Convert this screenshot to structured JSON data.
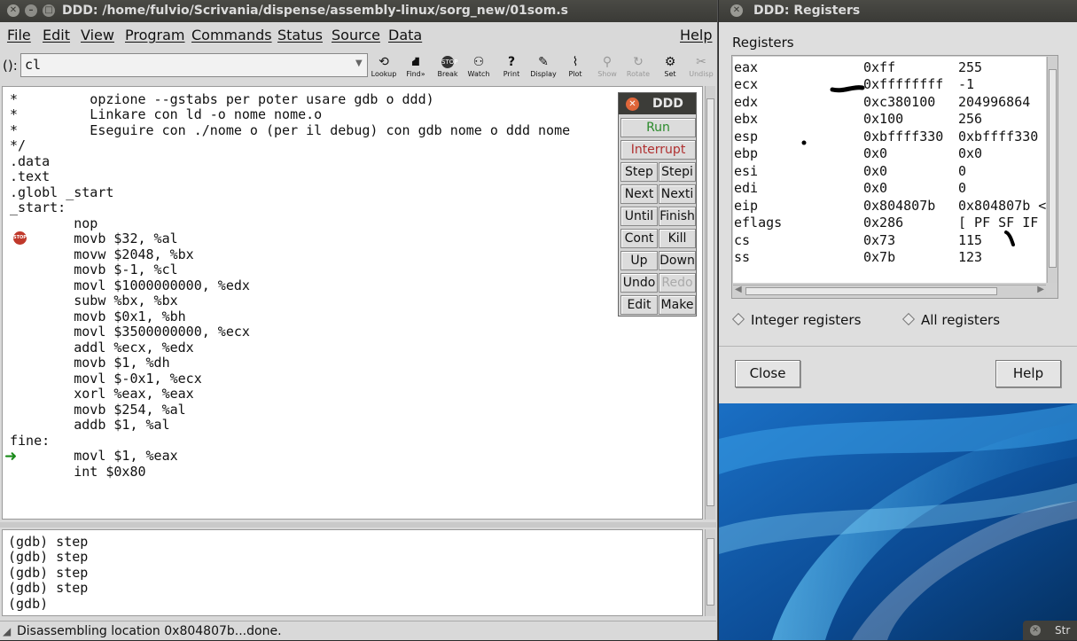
{
  "main_window": {
    "title": "DDD: /home/fulvio/Scrivania/dispense/assembly-linux/sorg_new/01som.s",
    "menu": [
      "File",
      "Edit",
      "View",
      "Program",
      "Commands",
      "Status",
      "Source",
      "Data",
      "Help"
    ],
    "arg_label": "():",
    "arg_value": "cl",
    "toolbar": [
      {
        "label": "Lookup",
        "icon": "lookup-icon",
        "enabled": true
      },
      {
        "label": "Find»",
        "icon": "find-icon",
        "enabled": true
      },
      {
        "label": "Break",
        "icon": "break-stop-icon",
        "enabled": true
      },
      {
        "label": "Watch",
        "icon": "watch-icon",
        "enabled": true
      },
      {
        "label": "Print",
        "icon": "print-icon",
        "enabled": true
      },
      {
        "label": "Display",
        "icon": "display-icon",
        "enabled": true
      },
      {
        "label": "Plot",
        "icon": "plot-icon",
        "enabled": true
      },
      {
        "label": "Show",
        "icon": "show-icon",
        "enabled": false
      },
      {
        "label": "Rotate",
        "icon": "rotate-icon",
        "enabled": false
      },
      {
        "label": "Set",
        "icon": "set-icon",
        "enabled": true
      },
      {
        "label": "Undisp",
        "icon": "undisp-icon",
        "enabled": false
      }
    ],
    "source_lines": [
      "*         opzione --gstabs per poter usare gdb o ddd)",
      "*         Linkare con ld -o nome nome.o",
      "*         Eseguire con ./nome o (per il debug) con gdb nome o ddd nome",
      "*/",
      ".data",
      ".text",
      ".globl _start",
      "_start:",
      "        nop",
      "        movb $32, %al",
      "        movw $2048, %bx",
      "        movb $-1, %cl",
      "        movl $1000000000, %edx",
      "        subw %bx, %bx",
      "        movb $0x1, %bh",
      "        movl $3500000000, %ecx",
      "        addl %ecx, %edx",
      "        movb $1, %dh",
      "        movl $-0x1, %ecx",
      "        xorl %eax, %eax",
      "        movb $254, %al",
      "        addb $1, %al",
      "fine:",
      "        movl $1, %eax",
      "        int $0x80"
    ],
    "breakpoint_icon": "stop-sign-icon",
    "execution_arrow_icon": "green-arrow-icon",
    "console_lines": [
      "(gdb) step",
      "(gdb) step",
      "(gdb) step",
      "(gdb) step",
      "(gdb)"
    ],
    "status_text": "Disassembling location 0x804807b...done."
  },
  "command_tool": {
    "title": "DDD",
    "buttons": [
      "Run",
      "Interrupt",
      "Step",
      "Stepi",
      "Next",
      "Nexti",
      "Until",
      "Finish",
      "Cont",
      "Kill",
      "Up",
      "Down",
      "Undo",
      "Redo",
      "Edit",
      "Make"
    ],
    "disabled": [
      "Redo"
    ]
  },
  "registers_window": {
    "title": "DDD: Registers",
    "heading": "Registers",
    "rows": [
      {
        "name": "eax",
        "hex": "0xff",
        "val": "255"
      },
      {
        "name": "ecx",
        "hex": "0xffffffff",
        "val": "-1"
      },
      {
        "name": "edx",
        "hex": "0xc380100",
        "val": "204996864"
      },
      {
        "name": "ebx",
        "hex": "0x100",
        "val": "256"
      },
      {
        "name": "esp",
        "hex": "0xbffff330",
        "val": "0xbffff330"
      },
      {
        "name": "ebp",
        "hex": "0x0",
        "val": "0x0"
      },
      {
        "name": "esi",
        "hex": "0x0",
        "val": "0"
      },
      {
        "name": "edi",
        "hex": "0x0",
        "val": "0"
      },
      {
        "name": "eip",
        "hex": "0x804807b",
        "val": "0x804807b <"
      },
      {
        "name": "eflags",
        "hex": "0x286",
        "val": "[ PF SF IF"
      },
      {
        "name": "cs",
        "hex": "0x73",
        "val": "115"
      },
      {
        "name": "ss",
        "hex": "0x7b",
        "val": "123"
      }
    ],
    "radio_integer": "Integer registers",
    "radio_all": "All registers",
    "close_label": "Close",
    "help_label": "Help"
  },
  "taskbar": {
    "label": "Str"
  },
  "colors": {
    "desktop_blue": "#0f4f9a",
    "accent_green": "#2a8a2a",
    "stop_red": "#c0392b"
  }
}
